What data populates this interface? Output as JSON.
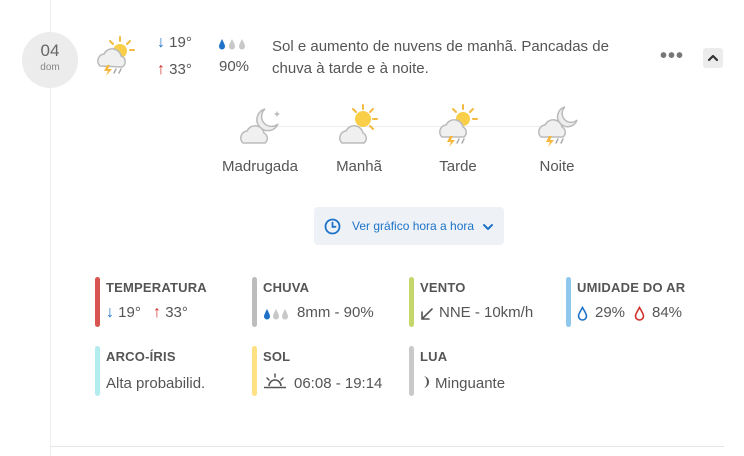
{
  "day": {
    "number": "04",
    "weekday": "dom"
  },
  "main_icon": "sun-cloud-rain-thunder-icon",
  "temps": {
    "min": "19°",
    "max": "33°"
  },
  "precip_prob": "90%",
  "summary": "Sol e aumento de nuvens de manhã. Pancadas de chuva à tarde e à noite.",
  "more_icon": "•••",
  "periods": [
    {
      "label": "Madrugada",
      "icon": "moon-cloud-icon"
    },
    {
      "label": "Manhã",
      "icon": "sun-cloud-icon"
    },
    {
      "label": "Tarde",
      "icon": "sun-cloud-thunder-icon"
    },
    {
      "label": "Noite",
      "icon": "moon-cloud-thunder-icon"
    }
  ],
  "hourly_button": "Ver gráfico hora a hora",
  "cards": {
    "temperature": {
      "title": "TEMPERATURA",
      "min": "19°",
      "max": "33°",
      "color": "#d9534f"
    },
    "rain": {
      "title": "CHUVA",
      "value": "8mm - 90%",
      "color": "#bdbdbd"
    },
    "wind": {
      "title": "VENTO",
      "value": "NNE - 10km/h",
      "color": "#c5d66a"
    },
    "humidity": {
      "title": "UMIDADE DO AR",
      "min": "29%",
      "max": "84%",
      "color": "#8ec8ee"
    },
    "rainbow": {
      "title": "ARCO-ÍRIS",
      "value": "Alta probabilid.",
      "color": "#b3ecef"
    },
    "sun": {
      "title": "SOL",
      "value": "06:08 - 19:14",
      "color": "#ffe082"
    },
    "moon": {
      "title": "LUA",
      "value": "Minguante",
      "color": "#c9c9c9"
    }
  }
}
